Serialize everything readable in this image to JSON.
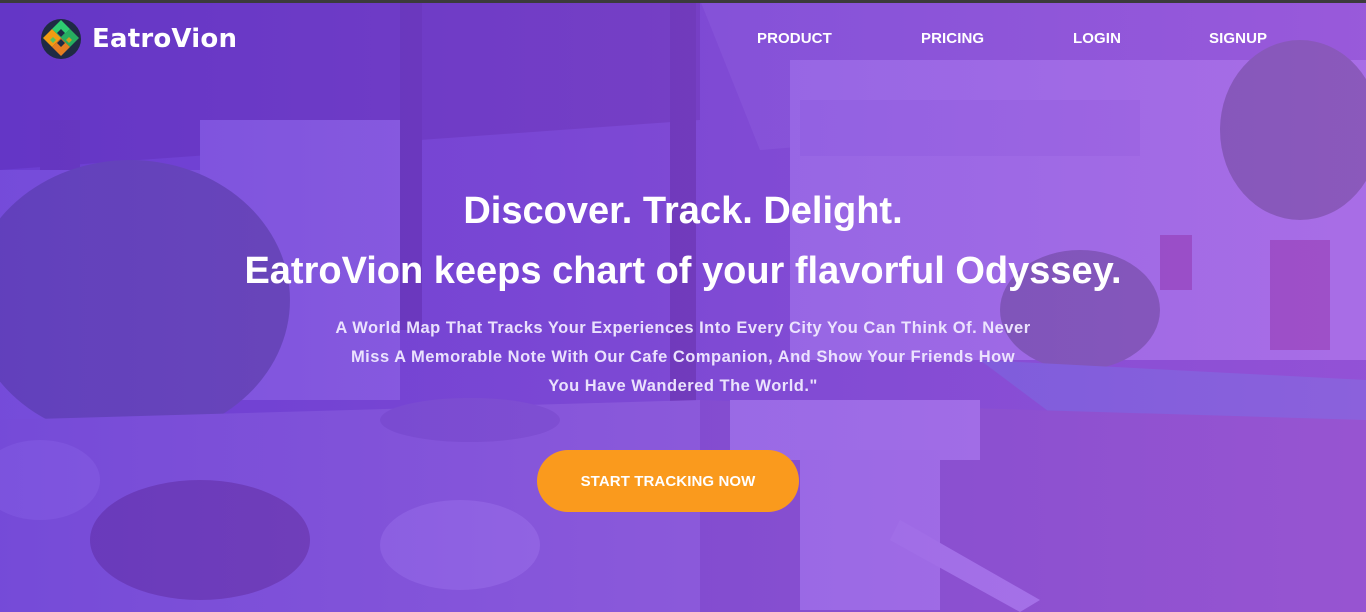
{
  "brand": {
    "name": "EatroVion",
    "logo_icon": "geometric-globe-icon",
    "logo_colors": [
      "#2ecc71",
      "#f39c12",
      "#e67e22",
      "#27ae60"
    ]
  },
  "nav": {
    "items": [
      {
        "label": "PRODUCT"
      },
      {
        "label": "PRICING"
      },
      {
        "label": "LOGIN"
      },
      {
        "label": "SIGNUP"
      }
    ]
  },
  "hero": {
    "headline_line1": "Discover. Track. Delight.",
    "headline_line2": "EatroVion keeps chart of your flavorful Odyssey.",
    "subtext": "A World Map That Tracks Your Experiences Into Every City You Can Think Of. Never Miss A Memorable Note With Our Cafe Companion, And Show Your Friends How You Have Wandered The World.\"",
    "cta_label": "START TRACKING NOW"
  },
  "colors": {
    "overlay": "#7a45e0",
    "cta": "#fa9a1d",
    "text": "#ffffff"
  }
}
